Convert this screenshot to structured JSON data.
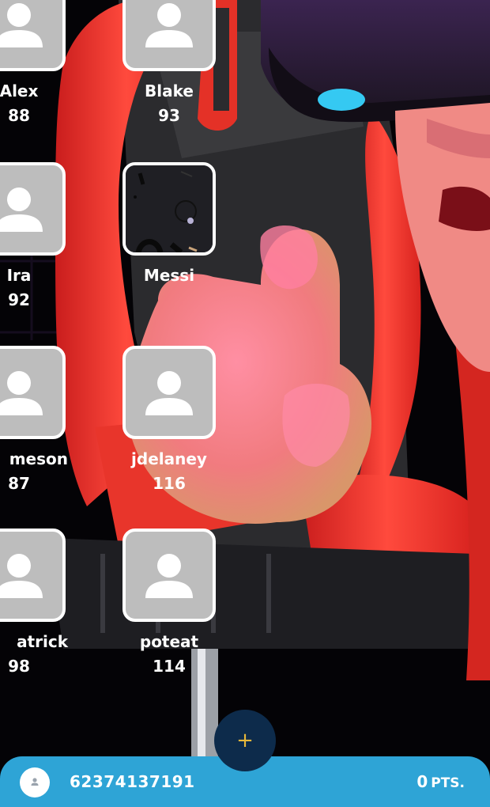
{
  "players": [
    {
      "name": "Alex",
      "score": "88",
      "avatar": "default-avatar-icon"
    },
    {
      "name": "Blake",
      "score": "93",
      "avatar": "default-avatar-icon"
    },
    {
      "name": "Ira",
      "score": "92",
      "avatar": "default-avatar-icon"
    },
    {
      "name": "Messi",
      "score": "",
      "avatar": "custom-photo"
    },
    {
      "name": "meson",
      "score": "87",
      "avatar": "default-avatar-icon"
    },
    {
      "name": "jdelaney",
      "score": "116",
      "avatar": "default-avatar-icon"
    },
    {
      "name": "atrick",
      "score": "98",
      "avatar": "default-avatar-icon"
    },
    {
      "name": "poteat",
      "score": "114",
      "avatar": "default-avatar-icon"
    }
  ],
  "fab": {
    "label": "+",
    "icon": "plus-icon"
  },
  "bottom_bar": {
    "user_id": "62374137191",
    "points_value": "0",
    "points_unit": "PTS.",
    "avatar_icon": "user-icon"
  },
  "colors": {
    "bottom_bar": "#2ea4d6",
    "fab_bg": "#0d2b4b",
    "fab_plus": "#e8b83a",
    "avatar_placeholder": "#bdbdbd",
    "chair_red": "#ef3b33",
    "skin": "#f08a85",
    "visor_blue": "#35c9f2"
  }
}
